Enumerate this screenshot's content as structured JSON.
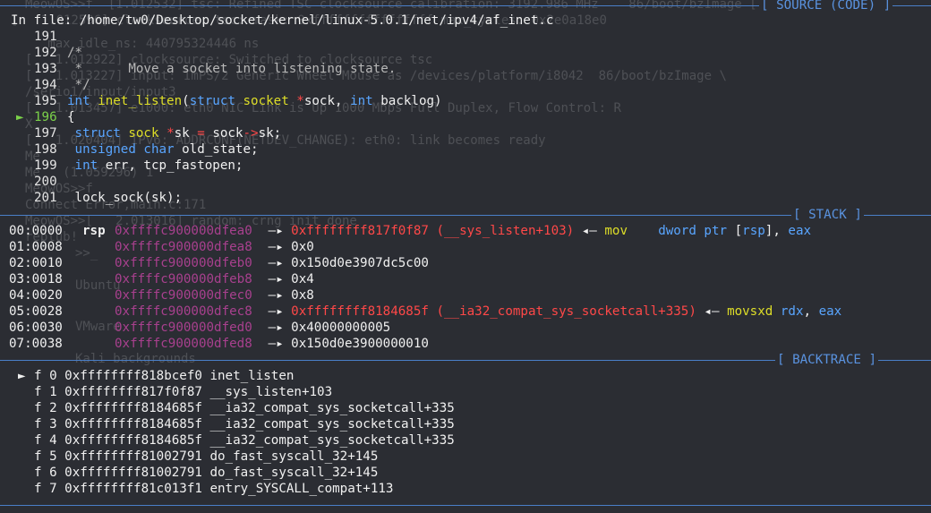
{
  "background_text": [
    "MeowOS>>f  [1.012532] tsc: Refined TSC clocksource calibration: 3192.986 MHz    86/boot/bzImage [",
    "[   1.012596] clocksource: tsc: mask: 0xffffffffffffffff max_cycles: 0x2e0a18e0",
    "   max_idle_ns: 440795324446 ns",
    "[   1.012922] clocksource: Switched to clocksource tsc",
    "[   1.013227] input: ImPS/2 Generic Wheel Mouse as /devices/platform/i8042  86/boot/bzImage \\",
    "/serio1/input/input3",
    "[   1.013457] e1000: eth0 NIC Link is Up 1000 Mbps Full Duplex, Flow Control: R",
    "X",
    "[   1.020404] IPv6: ADDRCONF(NETDEV_CHANGE): eth0: link becomes ready",
    "Me",
    "Me   (1.059296) 1",
    "MeowOS>>f",
    "Connect Error,main.c:171",
    "MeowOS>>[   2.013016] random: crng init done",
    "replub!",
    ">>_",
    "Ubuntu",
    "VMware",
    "Kali backgrounds"
  ],
  "source": {
    "title": "[ SOURCE (CODE) ]",
    "file_label": "In file: /home/tw0/Desktop/socket/kernel/linux-5.0.1/net/ipv4/af_inet.c",
    "marker": "►",
    "lines": [
      {
        "num": "191",
        "segments": [
          {
            "t": "",
            "c": "white"
          }
        ]
      },
      {
        "num": "192",
        "segments": [
          {
            "t": "/*",
            "c": "cmt"
          }
        ]
      },
      {
        "num": "193",
        "segments": [
          {
            "t": " *      Move a socket into listening state.",
            "c": "cmt"
          }
        ]
      },
      {
        "num": "194",
        "segments": [
          {
            "t": " */",
            "c": "cmt"
          }
        ]
      },
      {
        "num": "195",
        "segments": [
          {
            "t": "int ",
            "c": "kw"
          },
          {
            "t": "inet_listen",
            "c": "fn"
          },
          {
            "t": "(",
            "c": "white"
          },
          {
            "t": "struct ",
            "c": "kw"
          },
          {
            "t": "socket ",
            "c": "fn"
          },
          {
            "t": "*",
            "c": "red"
          },
          {
            "t": "sock, ",
            "c": "white"
          },
          {
            "t": "int ",
            "c": "kw"
          },
          {
            "t": "backlog)",
            "c": "white"
          }
        ]
      },
      {
        "num": "196",
        "current": true,
        "segments": [
          {
            "t": "{",
            "c": "white"
          }
        ]
      },
      {
        "num": "197",
        "segments": [
          {
            "t": " struct ",
            "c": "kw"
          },
          {
            "t": "sock ",
            "c": "fn"
          },
          {
            "t": "*",
            "c": "red"
          },
          {
            "t": "sk ",
            "c": "white"
          },
          {
            "t": "=",
            "c": "red"
          },
          {
            "t": " sock",
            "c": "white"
          },
          {
            "t": "->",
            "c": "red"
          },
          {
            "t": "sk;",
            "c": "white"
          }
        ]
      },
      {
        "num": "198",
        "segments": [
          {
            "t": " unsigned char ",
            "c": "kw"
          },
          {
            "t": "old_state;",
            "c": "white"
          }
        ]
      },
      {
        "num": "199",
        "segments": [
          {
            "t": " int ",
            "c": "kw"
          },
          {
            "t": "err, tcp_fastopen;",
            "c": "white"
          }
        ]
      },
      {
        "num": "200",
        "segments": [
          {
            "t": "",
            "c": "white"
          }
        ]
      },
      {
        "num": "201",
        "segments": [
          {
            "t": " lock_sock(sk);",
            "c": "white"
          }
        ]
      }
    ]
  },
  "stack": {
    "title": "[ STACK ]",
    "rows": [
      {
        "off": "00:0000",
        "reg": "rsp",
        "addr": "0xffffc900000dfea0",
        "segments": [
          {
            "t": " —▸ ",
            "c": "white"
          },
          {
            "t": "0xffffffff817f0f87 (__sys_listen+103)",
            "c": "red"
          },
          {
            "t": " ◂— ",
            "c": "white"
          },
          {
            "t": "mov    ",
            "c": "yel"
          },
          {
            "t": "dword ptr ",
            "c": "blue"
          },
          {
            "t": "[",
            "c": "white"
          },
          {
            "t": "rsp",
            "c": "blue"
          },
          {
            "t": "], ",
            "c": "white"
          },
          {
            "t": "eax",
            "c": "blue"
          }
        ]
      },
      {
        "off": "01:0008",
        "reg": "",
        "addr": "0xffffc900000dfea8",
        "segments": [
          {
            "t": " —▸ 0x0",
            "c": "white"
          }
        ]
      },
      {
        "off": "02:0010",
        "reg": "",
        "addr": "0xffffc900000dfeb0",
        "segments": [
          {
            "t": " —▸ 0x150d0e3907dc5c00",
            "c": "white"
          }
        ]
      },
      {
        "off": "03:0018",
        "reg": "",
        "addr": "0xffffc900000dfeb8",
        "segments": [
          {
            "t": " —▸ 0x4",
            "c": "white"
          }
        ]
      },
      {
        "off": "04:0020",
        "reg": "",
        "addr": "0xffffc900000dfec0",
        "segments": [
          {
            "t": " —▸ 0x8",
            "c": "white"
          }
        ]
      },
      {
        "off": "05:0028",
        "reg": "",
        "addr": "0xffffc900000dfec8",
        "segments": [
          {
            "t": " —▸ ",
            "c": "white"
          },
          {
            "t": "0xffffffff8184685f (__ia32_compat_sys_socketcall+335)",
            "c": "red"
          },
          {
            "t": " ◂— ",
            "c": "white"
          },
          {
            "t": "movsxd ",
            "c": "yel"
          },
          {
            "t": "rdx",
            "c": "blue"
          },
          {
            "t": ", ",
            "c": "white"
          },
          {
            "t": "eax",
            "c": "blue"
          }
        ]
      },
      {
        "off": "06:0030",
        "reg": "",
        "addr": "0xffffc900000dfed0",
        "segments": [
          {
            "t": " —▸ 0x40000000005",
            "c": "white"
          }
        ]
      },
      {
        "off": "07:0038",
        "reg": "",
        "addr": "0xffffc900000dfed8",
        "segments": [
          {
            "t": " —▸ 0x150d0e3900000010",
            "c": "white"
          }
        ]
      }
    ]
  },
  "backtrace": {
    "title": "[ BACKTRACE ]",
    "marker": "►",
    "frames": [
      {
        "idx": "f 0",
        "addr": "0xffffffff818bcef0",
        "sym": "inet_listen",
        "current": true
      },
      {
        "idx": "f 1",
        "addr": "0xffffffff817f0f87",
        "sym": "__sys_listen+103"
      },
      {
        "idx": "f 2",
        "addr": "0xffffffff8184685f",
        "sym": "__ia32_compat_sys_socketcall+335"
      },
      {
        "idx": "f 3",
        "addr": "0xffffffff8184685f",
        "sym": "__ia32_compat_sys_socketcall+335"
      },
      {
        "idx": "f 4",
        "addr": "0xffffffff8184685f",
        "sym": "__ia32_compat_sys_socketcall+335"
      },
      {
        "idx": "f 5",
        "addr": "0xffffffff81002791",
        "sym": "do_fast_syscall_32+145"
      },
      {
        "idx": "f 6",
        "addr": "0xffffffff81002791",
        "sym": "do_fast_syscall_32+145"
      },
      {
        "idx": "f 7",
        "addr": "0xffffffff81c013f1",
        "sym": "entry_SYSCALL_compat+113"
      }
    ]
  }
}
